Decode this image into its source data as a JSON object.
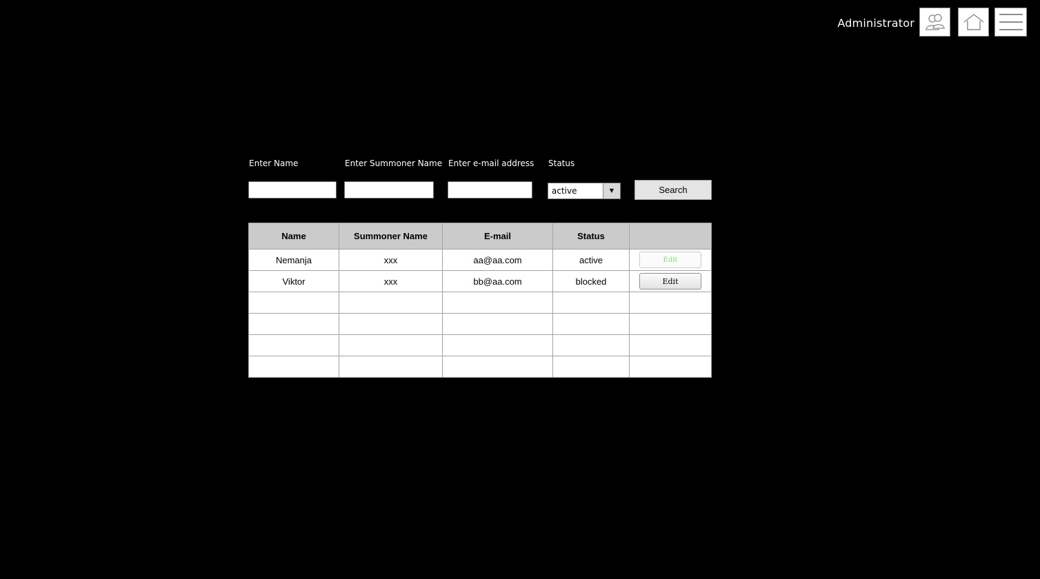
{
  "header": {
    "user_label": "Administrator",
    "icons": [
      "users-icon",
      "home-icon",
      "hamburger-menu-icon"
    ]
  },
  "filters": {
    "name_label": "Enter Name",
    "name_value": "",
    "summoner_label": "Enter Summoner Name",
    "summoner_value": "",
    "email_label": "Enter e-mail address",
    "email_value": "",
    "status_label": "Status",
    "status_value": "active",
    "search_label": "Search"
  },
  "table": {
    "columns": [
      "Name",
      "Summoner Name",
      "E-mail",
      "Status",
      ""
    ],
    "rows": [
      {
        "name": "Nemanja",
        "summoner": "xxx",
        "email": "aa@aa.com",
        "status": "active",
        "action": "Edit"
      },
      {
        "name": "Viktor",
        "summoner": "xxx",
        "email": "bb@aa.com",
        "status": "blocked",
        "action": "Edit"
      }
    ]
  },
  "colors": {
    "background": "#000000",
    "header_cell": "#cbcbcb",
    "faded_button_text": "#7ee07e"
  }
}
